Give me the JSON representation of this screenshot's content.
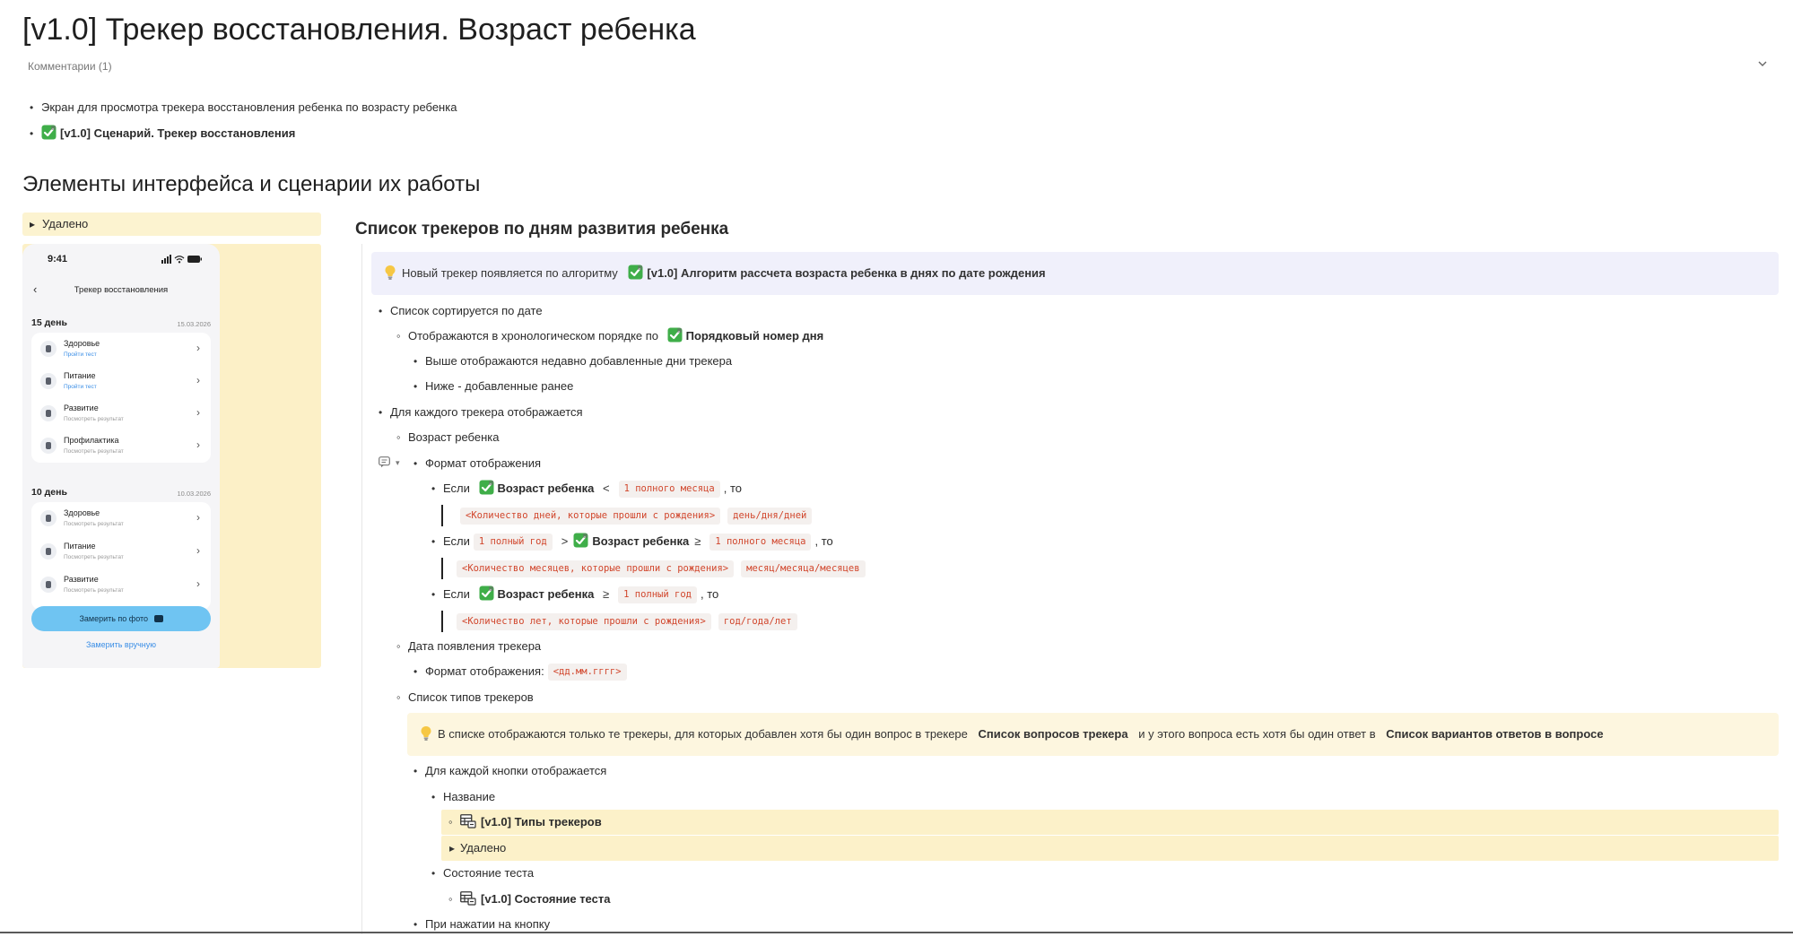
{
  "page": {
    "title": "[v1.0] Трекер восстановления. Возраст ребенка",
    "comments_label": "Комментарии (1)"
  },
  "intro": [
    "Экран для просмотра трекера восстановления ребенка по возрасту ребенка",
    "[v1.0] Сценарий. Трекер восстановления"
  ],
  "section": {
    "heading": "Элементы интерфейса и сценарии их работы",
    "deleted_label": "Удалено"
  },
  "phone": {
    "time": "9:41",
    "nav_title": "Трекер восстановления",
    "days": [
      {
        "title": "15 день",
        "date": "15.03.2026",
        "rows": [
          {
            "title": "Здоровье",
            "sub": "Пройти тест"
          },
          {
            "title": "Питание",
            "sub": "Пройти тест"
          },
          {
            "title": "Развитие",
            "sub": "Посмотреть результат"
          },
          {
            "title": "Профилактика",
            "sub": "Посмотреть результат"
          }
        ]
      },
      {
        "title": "10 день",
        "date": "10.03.2026",
        "rows": [
          {
            "title": "Здоровье",
            "sub": "Посмотреть результат"
          },
          {
            "title": "Питание",
            "sub": "Посмотреть результат"
          },
          {
            "title": "Развитие",
            "sub": "Посмотреть результат"
          }
        ]
      }
    ],
    "photo_button": "Замерить по фото",
    "manual_link": "Замерить вручную"
  },
  "right": {
    "heading": "Список трекеров по дням развития ребенка",
    "callout_algo": {
      "text": "Новый трекер появляется по алгоритму",
      "link": "[v1.0] Алгоритм рассчета возраста ребенка в днях по дате рождения"
    },
    "sorted_by_date": "Список сортируется по дате",
    "chrono_order": "Отображаются в хронологическом порядке по",
    "day_number": "Порядковый номер дня",
    "recent_above": "Выше отображаются недавно добавленные дни трекера",
    "older_below": "Ниже - добавленные ранее",
    "for_each_tracker": "Для каждого трекера отображается",
    "child_age": "Возраст ребенка",
    "display_format": "Формат отображения",
    "if": "Если",
    "then": ", то",
    "child_age_link": "Возраст ребенка",
    "lt": "<",
    "gt": ">",
    "ge": "≥",
    "one_full_month": "1 полного месяца",
    "one_full_year": "1 полный год",
    "days_count": "<Количество дней, которые прошли с рождения>",
    "days_word": "день/дня/дней",
    "months_count": "<Количество месяцев, которые прошли с рождения>",
    "months_word": "месяц/месяца/месяцев",
    "years_count": "<Количество лет, которые прошли с рождения>",
    "years_word": "год/года/лет",
    "appear_date": "Дата появления трекера",
    "format_label": "Формат отображения:",
    "date_format": "<дд.мм.гггг>",
    "types_list": "Список типов трекеров",
    "callout_list": {
      "part1": "В списке отображаются только те трекеры, для которых добавлен хотя бы один вопрос в трекере",
      "link1": "Список вопросов трекера",
      "part2": "и у этого вопроса есть хотя бы один ответ в",
      "link2": "Список вариантов ответов в вопросе"
    },
    "for_each_button": "Для каждой кнопки отображается",
    "name": "Название",
    "tracker_types": "[v1.0] Типы трекеров",
    "deleted": "Удалено",
    "test_state_label": "Состояние теста",
    "test_state_link": "[v1.0] Состояние теста",
    "on_button_press": "При нажатии на кнопку"
  },
  "colors": {
    "deleted_bg": "#fcf3d0",
    "callout_info": "#f0f0fb",
    "callout_warn": "#fdf6df",
    "code_text": "#d1462c",
    "accent_blue": "#6fc4f2"
  }
}
